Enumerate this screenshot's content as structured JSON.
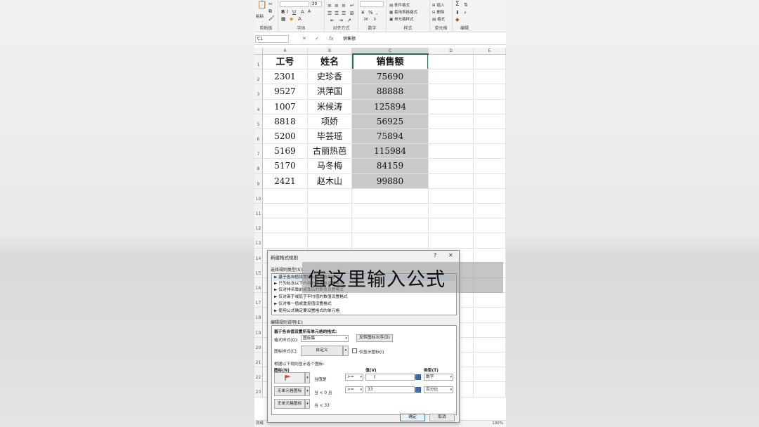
{
  "ribbon": {
    "groups": [
      {
        "label": "剪贴板"
      },
      {
        "label": "字体"
      },
      {
        "label": "对齐方式"
      },
      {
        "label": "数字"
      },
      {
        "label": "样式"
      },
      {
        "label": "单元格"
      },
      {
        "label": "编辑"
      }
    ],
    "paste_label": "粘贴",
    "font_size": "20",
    "number_format_symbol": "%",
    "style_items": [
      "条件格式",
      "套用表格格式",
      "单元格样式"
    ],
    "cell_items": [
      "插入",
      "删除",
      "格式"
    ]
  },
  "formula_bar": {
    "name_box": "C1",
    "fx": "fx",
    "value": "销售额"
  },
  "sheet": {
    "columns": [
      "A",
      "B",
      "C",
      "D",
      "E"
    ],
    "rows": [
      "1",
      "2",
      "3",
      "4",
      "5",
      "6",
      "7",
      "8",
      "9",
      "10",
      "11",
      "12",
      "13",
      "14",
      "15",
      "16",
      "17",
      "18",
      "19",
      "20",
      "21",
      "22",
      "23"
    ],
    "header": [
      "工号",
      "姓名",
      "销售额"
    ],
    "data": [
      [
        "2301",
        "史珍香",
        "75690"
      ],
      [
        "9527",
        "洪萍国",
        "88888"
      ],
      [
        "1007",
        "米候涛",
        "125894"
      ],
      [
        "8818",
        "项娇",
        "56925"
      ],
      [
        "5200",
        "毕芸瑶",
        "75894"
      ],
      [
        "5169",
        "古丽热芭",
        "115984"
      ],
      [
        "5170",
        "马冬梅",
        "84159"
      ],
      [
        "2421",
        "赵木山",
        "99880"
      ]
    ]
  },
  "dialog": {
    "title": "新建格式规则",
    "help": "?",
    "close": "✕",
    "select_rule_type_label": "选择规则类型(S):",
    "rule_types": [
      "► 基于各自值设置所有单元格的格式",
      "► 只为包含以下内容的单元格设置格式",
      "► 仅对排名靠前或靠后的数值设置格式",
      "► 仅对高于或低于平均值的数值设置格式",
      "► 仅对唯一值或重复值设置格式",
      "► 使用公式确定要设置格式的单元格"
    ],
    "edit_desc_label": "编辑规则说明(E):",
    "desc_heading": "基于各自值设置所有单元格的格式:",
    "format_style_label": "格式样式(O):",
    "format_style_value": "图标集",
    "reverse_button": "反转图标次序(D)",
    "icon_style_label": "图标样式(C):",
    "icon_style_value": "自定义",
    "show_icon_only": "仅显示图标(I)",
    "rules_caption": "根据以下规则显示各个图标:",
    "col_icon": "图标(N)",
    "col_value": "值(V)",
    "col_type": "类型(T)",
    "rows": [
      {
        "icon": "flag",
        "cond": "当值是",
        "op": ">=",
        "value": "",
        "type": "数字"
      },
      {
        "icon": "无单元格图标",
        "cond": "当 < 0 且",
        "op": ">=",
        "value": "33",
        "type": "百分比"
      },
      {
        "icon": "无单元格图标",
        "cond": "当 < 33",
        "op": "",
        "value": "",
        "type": ""
      }
    ],
    "ok": "确定",
    "cancel": "取消"
  },
  "caption": "值这里输入公式",
  "colors": {
    "accent": "#217346",
    "selection_fill": "#c9c9c9",
    "flag": "#d9412b"
  },
  "status": {
    "left": "就绪",
    "zoom": "100%"
  }
}
